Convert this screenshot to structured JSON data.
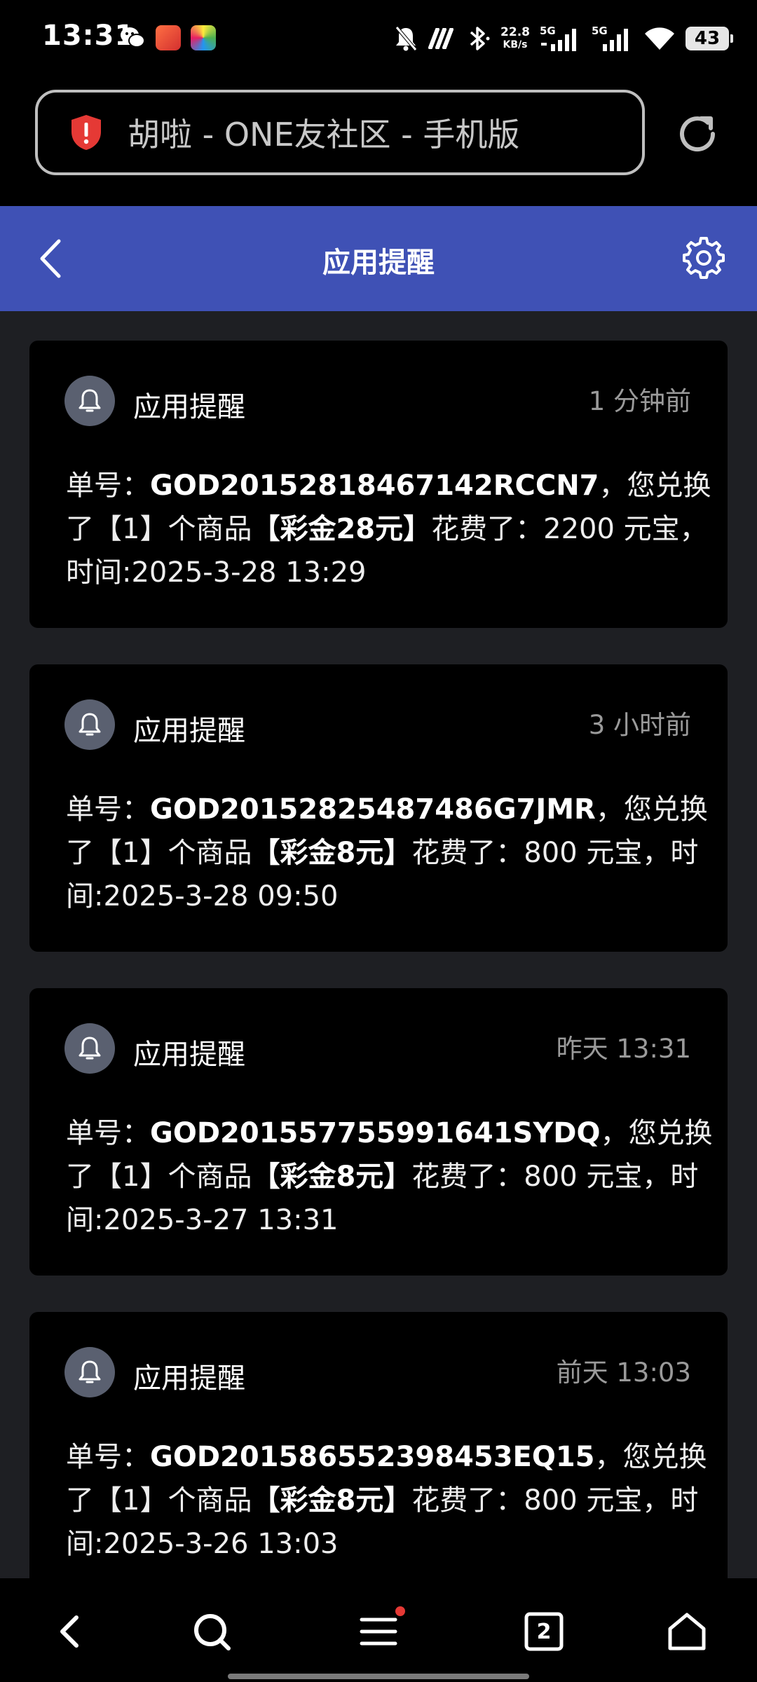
{
  "status_bar": {
    "time": "13:31",
    "net_speed_value": "22.8",
    "net_speed_unit": "KB/s",
    "sim1": "5G",
    "sim2": "5G",
    "battery": "43"
  },
  "browser": {
    "page_title": "胡啦 - ONE友社区 - 手机版"
  },
  "header": {
    "title": "应用提醒"
  },
  "notifications": [
    {
      "source": "应用提醒",
      "time": "1 分钟前",
      "prefix": "单号：",
      "order_no": "GOD20152818467142RCCN7",
      "mid": "，您兑换了【1】个商品",
      "product": "【彩金28元】",
      "suffix": "花费了：2200 元宝，时间:2025-3-28 13:29"
    },
    {
      "source": "应用提醒",
      "time": "3 小时前",
      "prefix": "单号：",
      "order_no": "GOD20152825487486G7JMR",
      "mid": "，您兑换了【1】个商品",
      "product": "【彩金8元】",
      "suffix": "花费了：800 元宝，时间:2025-3-28 09:50"
    },
    {
      "source": "应用提醒",
      "time": "昨天 13:31",
      "prefix": "单号：",
      "order_no": "GOD201557755991641SYDQ",
      "mid": "，您兑换了【1】个商品",
      "product": "【彩金8元】",
      "suffix": "花费了：800 元宝，时间:2025-3-27 13:31"
    },
    {
      "source": "应用提醒",
      "time": "前天 13:03",
      "prefix": "单号：",
      "order_no": "GOD201586552398453EQ15",
      "mid": "，您兑换了【1】个商品",
      "product": "【彩金8元】",
      "suffix": "花费了：800 元宝，时间:2025-3-26 13:03"
    }
  ],
  "bottom_nav": {
    "tab_count": "2"
  },
  "colors": {
    "header_bg": "#3f51b5",
    "content_bg": "#1e1f23",
    "card_bg": "#000000",
    "badge_red": "#e53935",
    "shield_red": "#e53935"
  },
  "icons": {
    "shield": "shield-alert-icon",
    "reload": "reload-icon",
    "back": "back-arrow-icon",
    "settings": "gear-icon",
    "bell": "bell-icon",
    "nav_back": "chevron-left-icon",
    "nav_search": "search-icon",
    "nav_menu": "menu-icon",
    "nav_tabs": "tabs-icon",
    "nav_home": "home-icon"
  }
}
